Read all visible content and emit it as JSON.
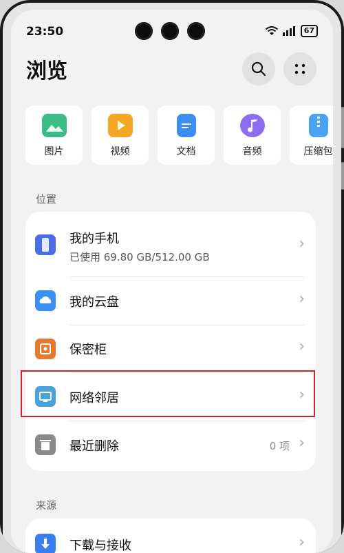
{
  "status_bar": {
    "time": "23:50",
    "battery": "67"
  },
  "header": {
    "title": "浏览",
    "search_icon": "search-icon",
    "more_icon": "more-dots-icon"
  },
  "categories": [
    {
      "label": "图片",
      "color": "#3dbd86",
      "icon": "image-icon"
    },
    {
      "label": "视频",
      "color": "#f5a623",
      "icon": "video-icon"
    },
    {
      "label": "文档",
      "color": "#3b8ef3",
      "icon": "document-icon"
    },
    {
      "label": "音频",
      "color": "#8e6ef0",
      "icon": "music-icon"
    },
    {
      "label": "压缩包",
      "color": "#4aa3f5",
      "icon": "zip-icon"
    }
  ],
  "locations": {
    "section_label": "位置",
    "items": [
      {
        "name": "我的手机",
        "sub": "已使用 69.80 GB/512.00 GB",
        "color": "#4a6ee8",
        "icon": "phone-icon"
      },
      {
        "name": "我的云盘",
        "color": "#3b8ef3",
        "icon": "cloud-icon"
      },
      {
        "name": "保密柜",
        "color": "#e57a2e",
        "icon": "safe-icon"
      },
      {
        "name": "网络邻居",
        "color": "#4aa3d8",
        "icon": "network-icon"
      },
      {
        "name": "最近删除",
        "count": "0 项",
        "color": "#8a8a8a",
        "icon": "trash-icon"
      }
    ]
  },
  "sources": {
    "section_label": "来源",
    "items": [
      {
        "name": "下载与接收",
        "color": "#3b7ef0",
        "icon": "download-icon"
      }
    ]
  },
  "chevron": "›"
}
